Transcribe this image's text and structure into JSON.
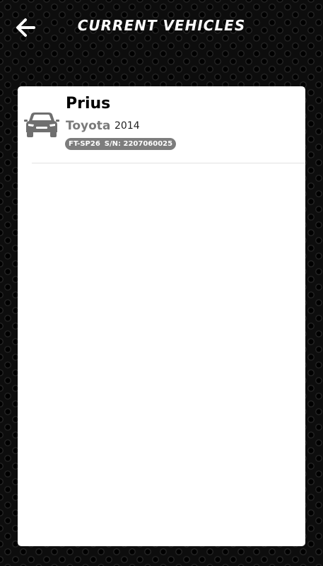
{
  "header": {
    "title": "CURRENT VEHICLES",
    "back_icon": "arrow-left-icon"
  },
  "vehicles": [
    {
      "model": "Prius",
      "make": "Toyota",
      "year": "2014",
      "device": "FT-SP26",
      "serial": "S/N: 2207060025",
      "icon": "car-icon"
    }
  ],
  "colors": {
    "background": "#0d0d0d",
    "panel": "#ffffff",
    "badge": "#7d7d7d",
    "make_text": "#7a7a7a"
  }
}
